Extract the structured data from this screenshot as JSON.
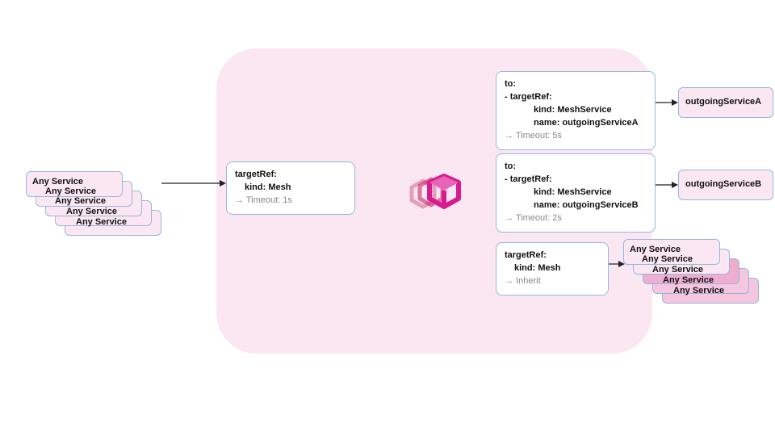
{
  "anyService": "Any Service",
  "leftCard": {
    "l1": "targetRef:",
    "l2": "kind: Mesh",
    "l3": "→ Timeout: 1s"
  },
  "rightA": {
    "l1": "to:",
    "l2": "-  targetRef:",
    "l3": "kind: MeshService",
    "l4": "name:  outgoingServiceA",
    "l5": "→ Timeout: 5s"
  },
  "rightB": {
    "l1": "to:",
    "l2": "-  targetRef:",
    "l3": "kind: MeshService",
    "l4": "name:  outgoingServiceB",
    "l5": "→ Timeout: 2s"
  },
  "rightC": {
    "l1": "targetRef:",
    "l2": "kind: Mesh",
    "l3": "→ Inherit"
  },
  "servA": "outgoingServiceA",
  "servB": "outgoingServiceB"
}
